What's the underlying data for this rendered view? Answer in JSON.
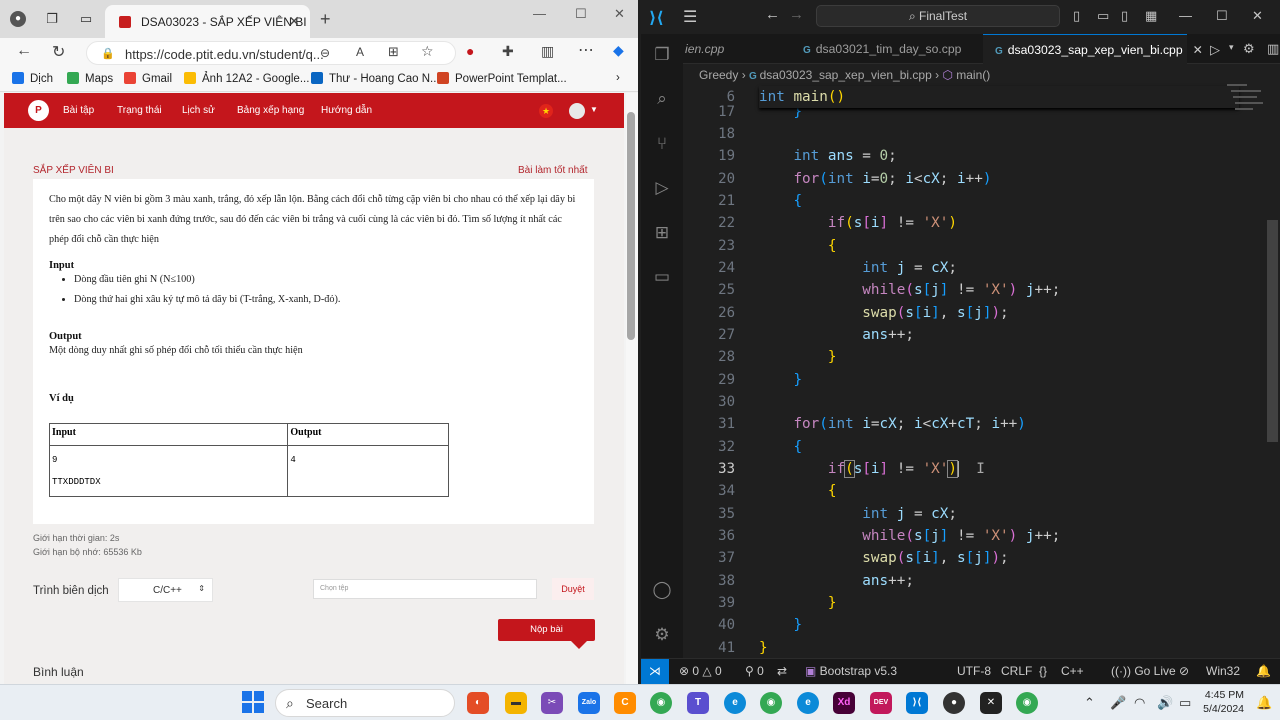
{
  "browser": {
    "tab_title": "DSA03023 - SẮP XẾP VIÊN BI",
    "url": "https://code.ptit.edu.vn/student/q...",
    "bookmarks": [
      "Dịch",
      "Maps",
      "Gmail",
      "Ảnh 12A2 - Google...",
      "Thư - Hoang Cao N...",
      "PowerPoint Templat..."
    ]
  },
  "site": {
    "nav": [
      "Bài tập",
      "Trạng thái",
      "Lịch sử",
      "Bảng xếp hạng",
      "Hướng dẫn"
    ],
    "problem_title": "SẮP XẾP VIÊN BI",
    "best_solution": "Bài làm tốt nhất",
    "description": "Cho một dãy N viên bi gồm 3 màu xanh, trắng, đỏ xếp lẫn lộn. Bằng cách đổi chỗ từng cặp viên bi cho nhau có thể xếp lại dãy bi trên sao cho các viên bi xanh đứng trước, sau đó đến các viên bi trắng và cuối cùng là các viên bi đỏ. Tìm số lượng ít nhất các phép đổi chỗ cần thực hiện",
    "input_heading": "Input",
    "input_items": [
      "Dòng đầu  tiên ghi N (N≤100)",
      "Dòng thứ hai ghi xâu ký tự mô tả dãy bi (T-trắng, X-xanh, D-đỏ)."
    ],
    "output_heading": "Output",
    "output_text": "Một dòng duy nhất ghi số phép đổi chỗ tối thiểu cần thực hiện",
    "example_heading": "Ví dụ",
    "table": {
      "h_in": "Input",
      "h_out": "Output",
      "in_1": "9",
      "in_2": "TTXDDDTDX",
      "out_1": "4"
    },
    "time_limit": "Giới hạn thời gian: 2s",
    "mem_limit": "Giới hạn bộ nhớ: 65536 Kb",
    "compiler_label": "Trình biên dịch",
    "compiler_value": "C/C++",
    "file_placeholder": "Chọn tệp",
    "browse": "Duyệt",
    "submit": "Nộp bài",
    "comments": "Bình luận"
  },
  "vscode": {
    "command_center": "FinalTest",
    "tabs": [
      "ien.cpp",
      "dsa03021_tim_day_so.cpp",
      "dsa03023_sap_xep_vien_bi.cpp"
    ],
    "breadcrumb": [
      "Greedy",
      "dsa03023_sap_xep_vien_bi.cpp",
      "main()"
    ],
    "line_numbers": [
      "6",
      "17",
      "18",
      "19",
      "20",
      "21",
      "22",
      "23",
      "24",
      "25",
      "26",
      "27",
      "28",
      "29",
      "30",
      "31",
      "32",
      "33",
      "34",
      "35",
      "36",
      "37",
      "38",
      "39",
      "40",
      "41"
    ],
    "status": {
      "errors": "0",
      "warnings": "0",
      "ports": "0",
      "bootstrap": "Bootstrap v5.3",
      "encoding": "UTF-8",
      "eol": "CRLF",
      "lang": "C++",
      "golive": "Go Live",
      "platform": "Win32"
    }
  },
  "taskbar": {
    "search": "Search",
    "time": "4:45 PM",
    "date": "5/4/2024"
  }
}
